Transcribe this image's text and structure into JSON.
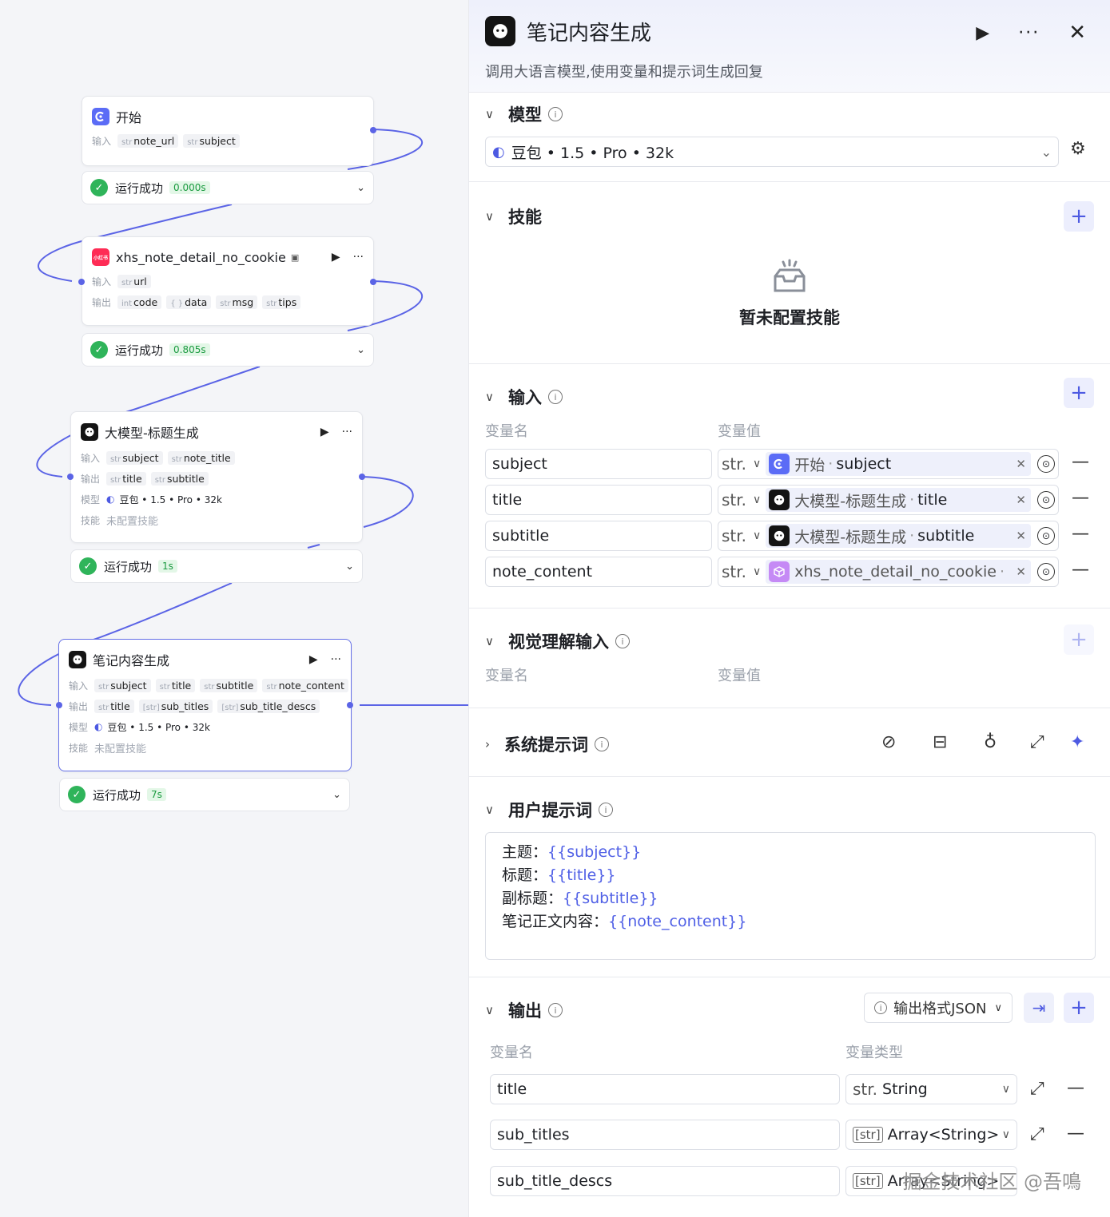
{
  "canvas": {
    "start": {
      "title": "开始",
      "input_label": "输入",
      "inputs": [
        {
          "type": "str",
          "name": "note_url"
        },
        {
          "type": "str",
          "name": "subject"
        }
      ],
      "status": "运行成功",
      "time": "0.000s"
    },
    "xhs": {
      "title": "xhs_note_detail_no_cookie",
      "icon_text": "小红书",
      "input_label": "输入",
      "output_label": "输出",
      "inputs": [
        {
          "type": "str",
          "name": "url"
        }
      ],
      "outputs": [
        {
          "type": "int",
          "name": "code"
        },
        {
          "type": "{ }",
          "name": "data"
        },
        {
          "type": "str",
          "name": "msg"
        },
        {
          "type": "str",
          "name": "tips"
        }
      ],
      "status": "运行成功",
      "time": "0.805s"
    },
    "title_gen": {
      "title": "大模型-标题生成",
      "input_label": "输入",
      "output_label": "输出",
      "model_label": "模型",
      "skill_label": "技能",
      "inputs": [
        {
          "type": "str",
          "name": "subject"
        },
        {
          "type": "str",
          "name": "note_title"
        }
      ],
      "outputs": [
        {
          "type": "str",
          "name": "title"
        },
        {
          "type": "str",
          "name": "subtitle"
        }
      ],
      "model": "豆包 • 1.5 • Pro • 32k",
      "skill": "未配置技能",
      "status": "运行成功",
      "time": "1s"
    },
    "content_gen": {
      "title": "笔记内容生成",
      "input_label": "输入",
      "output_label": "输出",
      "model_label": "模型",
      "skill_label": "技能",
      "inputs": [
        {
          "type": "str",
          "name": "subject"
        },
        {
          "type": "str",
          "name": "title"
        },
        {
          "type": "str",
          "name": "subtitle"
        },
        {
          "type": "str",
          "name": "note_content"
        }
      ],
      "outputs": [
        {
          "type": "str",
          "name": "title"
        },
        {
          "type": "[str]",
          "name": "sub_titles"
        },
        {
          "type": "[str]",
          "name": "sub_title_descs"
        }
      ],
      "model": "豆包 • 1.5 • Pro • 32k",
      "skill": "未配置技能",
      "status": "运行成功",
      "time": "7s"
    }
  },
  "panel": {
    "title": "笔记内容生成",
    "description": "调用大语言模型,使用变量和提示词生成回复",
    "model": {
      "label": "模型",
      "value": "豆包 • 1.5 • Pro • 32k"
    },
    "skills": {
      "label": "技能",
      "empty": "暂未配置技能"
    },
    "input": {
      "label": "输入",
      "col_name": "变量名",
      "col_value": "变量值",
      "rows": [
        {
          "name": "subject",
          "type": "str.",
          "source": "开始",
          "field": "subject"
        },
        {
          "name": "title",
          "type": "str.",
          "source": "大模型-标题生成",
          "field": "title"
        },
        {
          "name": "subtitle",
          "type": "str.",
          "source": "大模型-标题生成",
          "field": "subtitle"
        },
        {
          "name": "note_content",
          "type": "str.",
          "source": "xhs_note_detail_no_cookie",
          "field": ""
        }
      ]
    },
    "vision": {
      "label": "视觉理解输入",
      "col_name": "变量名",
      "col_value": "变量值"
    },
    "system_prompt": {
      "label": "系统提示词"
    },
    "user_prompt": {
      "label": "用户提示词",
      "lines": [
        {
          "prefix": "主题：",
          "var": "{{subject}}"
        },
        {
          "prefix": "标题：",
          "var": "{{title}}"
        },
        {
          "prefix": "副标题：",
          "var": "{{subtitle}}"
        },
        {
          "prefix": "笔记正文内容：",
          "var": "{{note_content}}"
        }
      ]
    },
    "output": {
      "label": "输出",
      "format_button": "输出格式JSON",
      "col_name": "变量名",
      "col_type": "变量类型",
      "rows": [
        {
          "name": "title",
          "type_icon": "str.",
          "type": "String"
        },
        {
          "name": "sub_titles",
          "type_icon": "[str]",
          "type": "Array<String>"
        },
        {
          "name": "sub_title_descs",
          "type_icon": "[str]",
          "type": "Array<String>"
        }
      ]
    }
  },
  "watermark": "掘金技术社区 @吾鳴",
  "colors": {
    "accent": "#5b64e6",
    "success": "#2fb45a",
    "xhs": "#fe2c55"
  },
  "icons": [
    "play-icon",
    "more-icon",
    "close-icon",
    "chevron-down-icon",
    "info-icon",
    "settings-icon",
    "plus-icon",
    "minus-icon",
    "compass-icon",
    "library-icon",
    "bulb-icon",
    "expand-icon",
    "sparkle-icon",
    "check-icon"
  ]
}
